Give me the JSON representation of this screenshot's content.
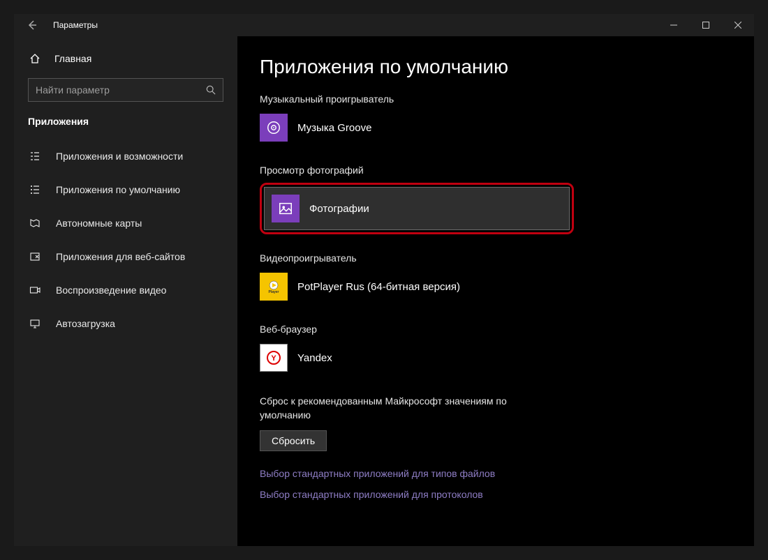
{
  "titlebar": {
    "title": "Параметры"
  },
  "sidebar": {
    "home": "Главная",
    "search_placeholder": "Найти параметр",
    "category": "Приложения",
    "items": [
      {
        "label": "Приложения и возможности"
      },
      {
        "label": "Приложения по умолчанию"
      },
      {
        "label": "Автономные карты"
      },
      {
        "label": "Приложения для веб-сайтов"
      },
      {
        "label": "Воспроизведение видео"
      },
      {
        "label": "Автозагрузка"
      }
    ]
  },
  "main": {
    "heading": "Приложения по умолчанию",
    "sections": {
      "music": {
        "label": "Музыкальный проигрыватель",
        "app": "Музыка Groove"
      },
      "photo": {
        "label": "Просмотр фотографий",
        "app": "Фотографии"
      },
      "video": {
        "label": "Видеопроигрыватель",
        "app": "PotPlayer Rus (64-битная версия)"
      },
      "browser": {
        "label": "Веб-браузер",
        "app": "Yandex"
      }
    },
    "reset": {
      "text": "Сброс к рекомендованным Майкрософт значениям по умолчанию",
      "button": "Сбросить"
    },
    "links": {
      "by_filetype": "Выбор стандартных приложений для типов файлов",
      "by_protocol": "Выбор стандартных приложений для протоколов"
    }
  }
}
